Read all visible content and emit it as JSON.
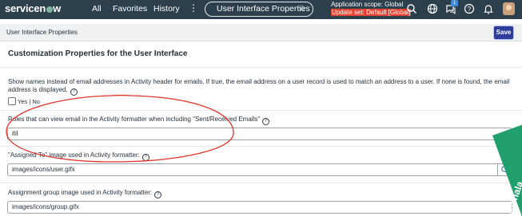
{
  "nav": {
    "brand": "servicenow",
    "brand_before": "servicen",
    "brand_after": "w",
    "items": [
      "All",
      "Favorites",
      "History"
    ],
    "current_page": "User Interface Properties",
    "scope_line1": "Application scope: Global",
    "scope_line2": "Update set: Default [Global]",
    "notification_count": "1",
    "icons": [
      "more-options-icon",
      "favorite-star-icon",
      "search-icon",
      "globe-icon",
      "chat-icon",
      "help-icon",
      "bell-icon",
      "avatar"
    ]
  },
  "header": {
    "title": "User Interface Properties",
    "save_label": "Save"
  },
  "section": {
    "title": "Customization Properties for the User Interface"
  },
  "properties": [
    {
      "label": "Show names instead of email addresses in Activity header for emails. If true, the email address on a user record is used to match an address to a user. If none is found, the email address is displayed.",
      "options": "Yes | No"
    },
    {
      "label": "Roles that can view email in the Activity formatter when including \"Sent/Received Emails\"",
      "value": "itil"
    },
    {
      "label": "\"Assigned To\" image used in Activity formatter:",
      "value": "images/icons/user.gifx"
    },
    {
      "label": "Assignment group image used in Activity formatter:",
      "value": "images/icons/group.gifx"
    }
  ],
  "watermark": "thshala",
  "colors": {
    "nav_bg": "#2b3f4c",
    "save_bg": "#2e3d99",
    "update_set_bg": "#e8402e",
    "annotation_red": "#e0342a",
    "watermark_green": "#21a06e"
  }
}
